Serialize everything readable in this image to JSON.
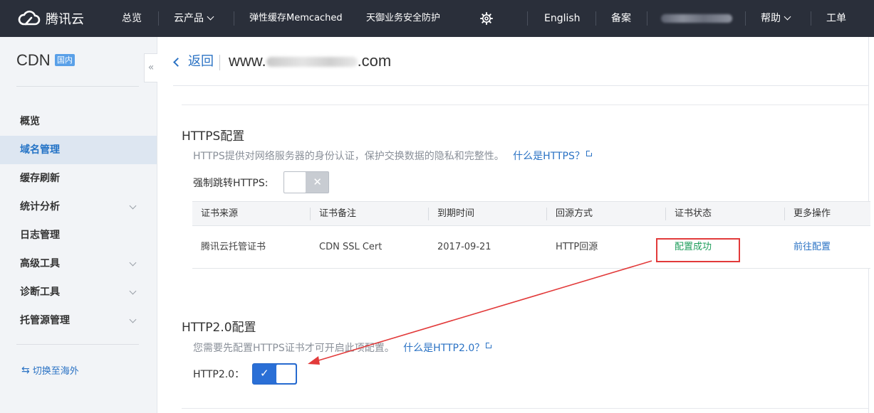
{
  "topnav": {
    "logo_text": "腾讯云",
    "items": {
      "overview": "总览",
      "products": "云产品",
      "memcached": "弹性缓存Memcached",
      "tianyu": "天御业务安全防护",
      "english": "English",
      "beian": "备案",
      "help": "帮助",
      "ticket": "工单"
    },
    "icons": {
      "settings": "gear-icon",
      "logo": "cloud-icon"
    }
  },
  "sidebar": {
    "title": "CDN",
    "badge": "国内",
    "items": [
      {
        "label": "概览",
        "active": false,
        "expandable": false
      },
      {
        "label": "域名管理",
        "active": true,
        "expandable": false
      },
      {
        "label": "缓存刷新",
        "active": false,
        "expandable": false
      },
      {
        "label": "统计分析",
        "active": false,
        "expandable": true
      },
      {
        "label": "日志管理",
        "active": false,
        "expandable": false
      },
      {
        "label": "高级工具",
        "active": false,
        "expandable": true
      },
      {
        "label": "诊断工具",
        "active": false,
        "expandable": true
      },
      {
        "label": "托管源管理",
        "active": false,
        "expandable": true
      }
    ],
    "switch_label": "切换至海外"
  },
  "header": {
    "back_label": "返回",
    "domain_prefix": "www.",
    "domain_suffix": ".com"
  },
  "https_section": {
    "title": "HTTPS配置",
    "description": "HTTPS提供对网络服务器的身份认证，保护交换数据的隐私和完整性。",
    "help_link": "什么是HTTPS？",
    "force_label": "强制跳转HTTPS:",
    "force_enabled": false
  },
  "cert_table": {
    "columns": [
      "证书来源",
      "证书备注",
      "到期时间",
      "回源方式",
      "证书状态",
      "更多操作"
    ],
    "rows": [
      [
        "腾讯云托管证书",
        "CDN SSL Cert",
        "2017-09-21",
        "HTTP回源",
        "配置成功",
        "前往配置"
      ]
    ]
  },
  "http2_section": {
    "title": "HTTP2.0配置",
    "description": "您需要先配置HTTPS证书才可开启此项配置。",
    "help_link": "什么是HTTP2.0？",
    "toggle_label": "HTTP2.0：",
    "enabled": true
  },
  "colors": {
    "nav_bg": "#2a2f3a",
    "accent": "#2a72c4",
    "success": "#1f9e5c",
    "annotation": "#e23a3a",
    "toggle_on": "#2a6fd6"
  }
}
